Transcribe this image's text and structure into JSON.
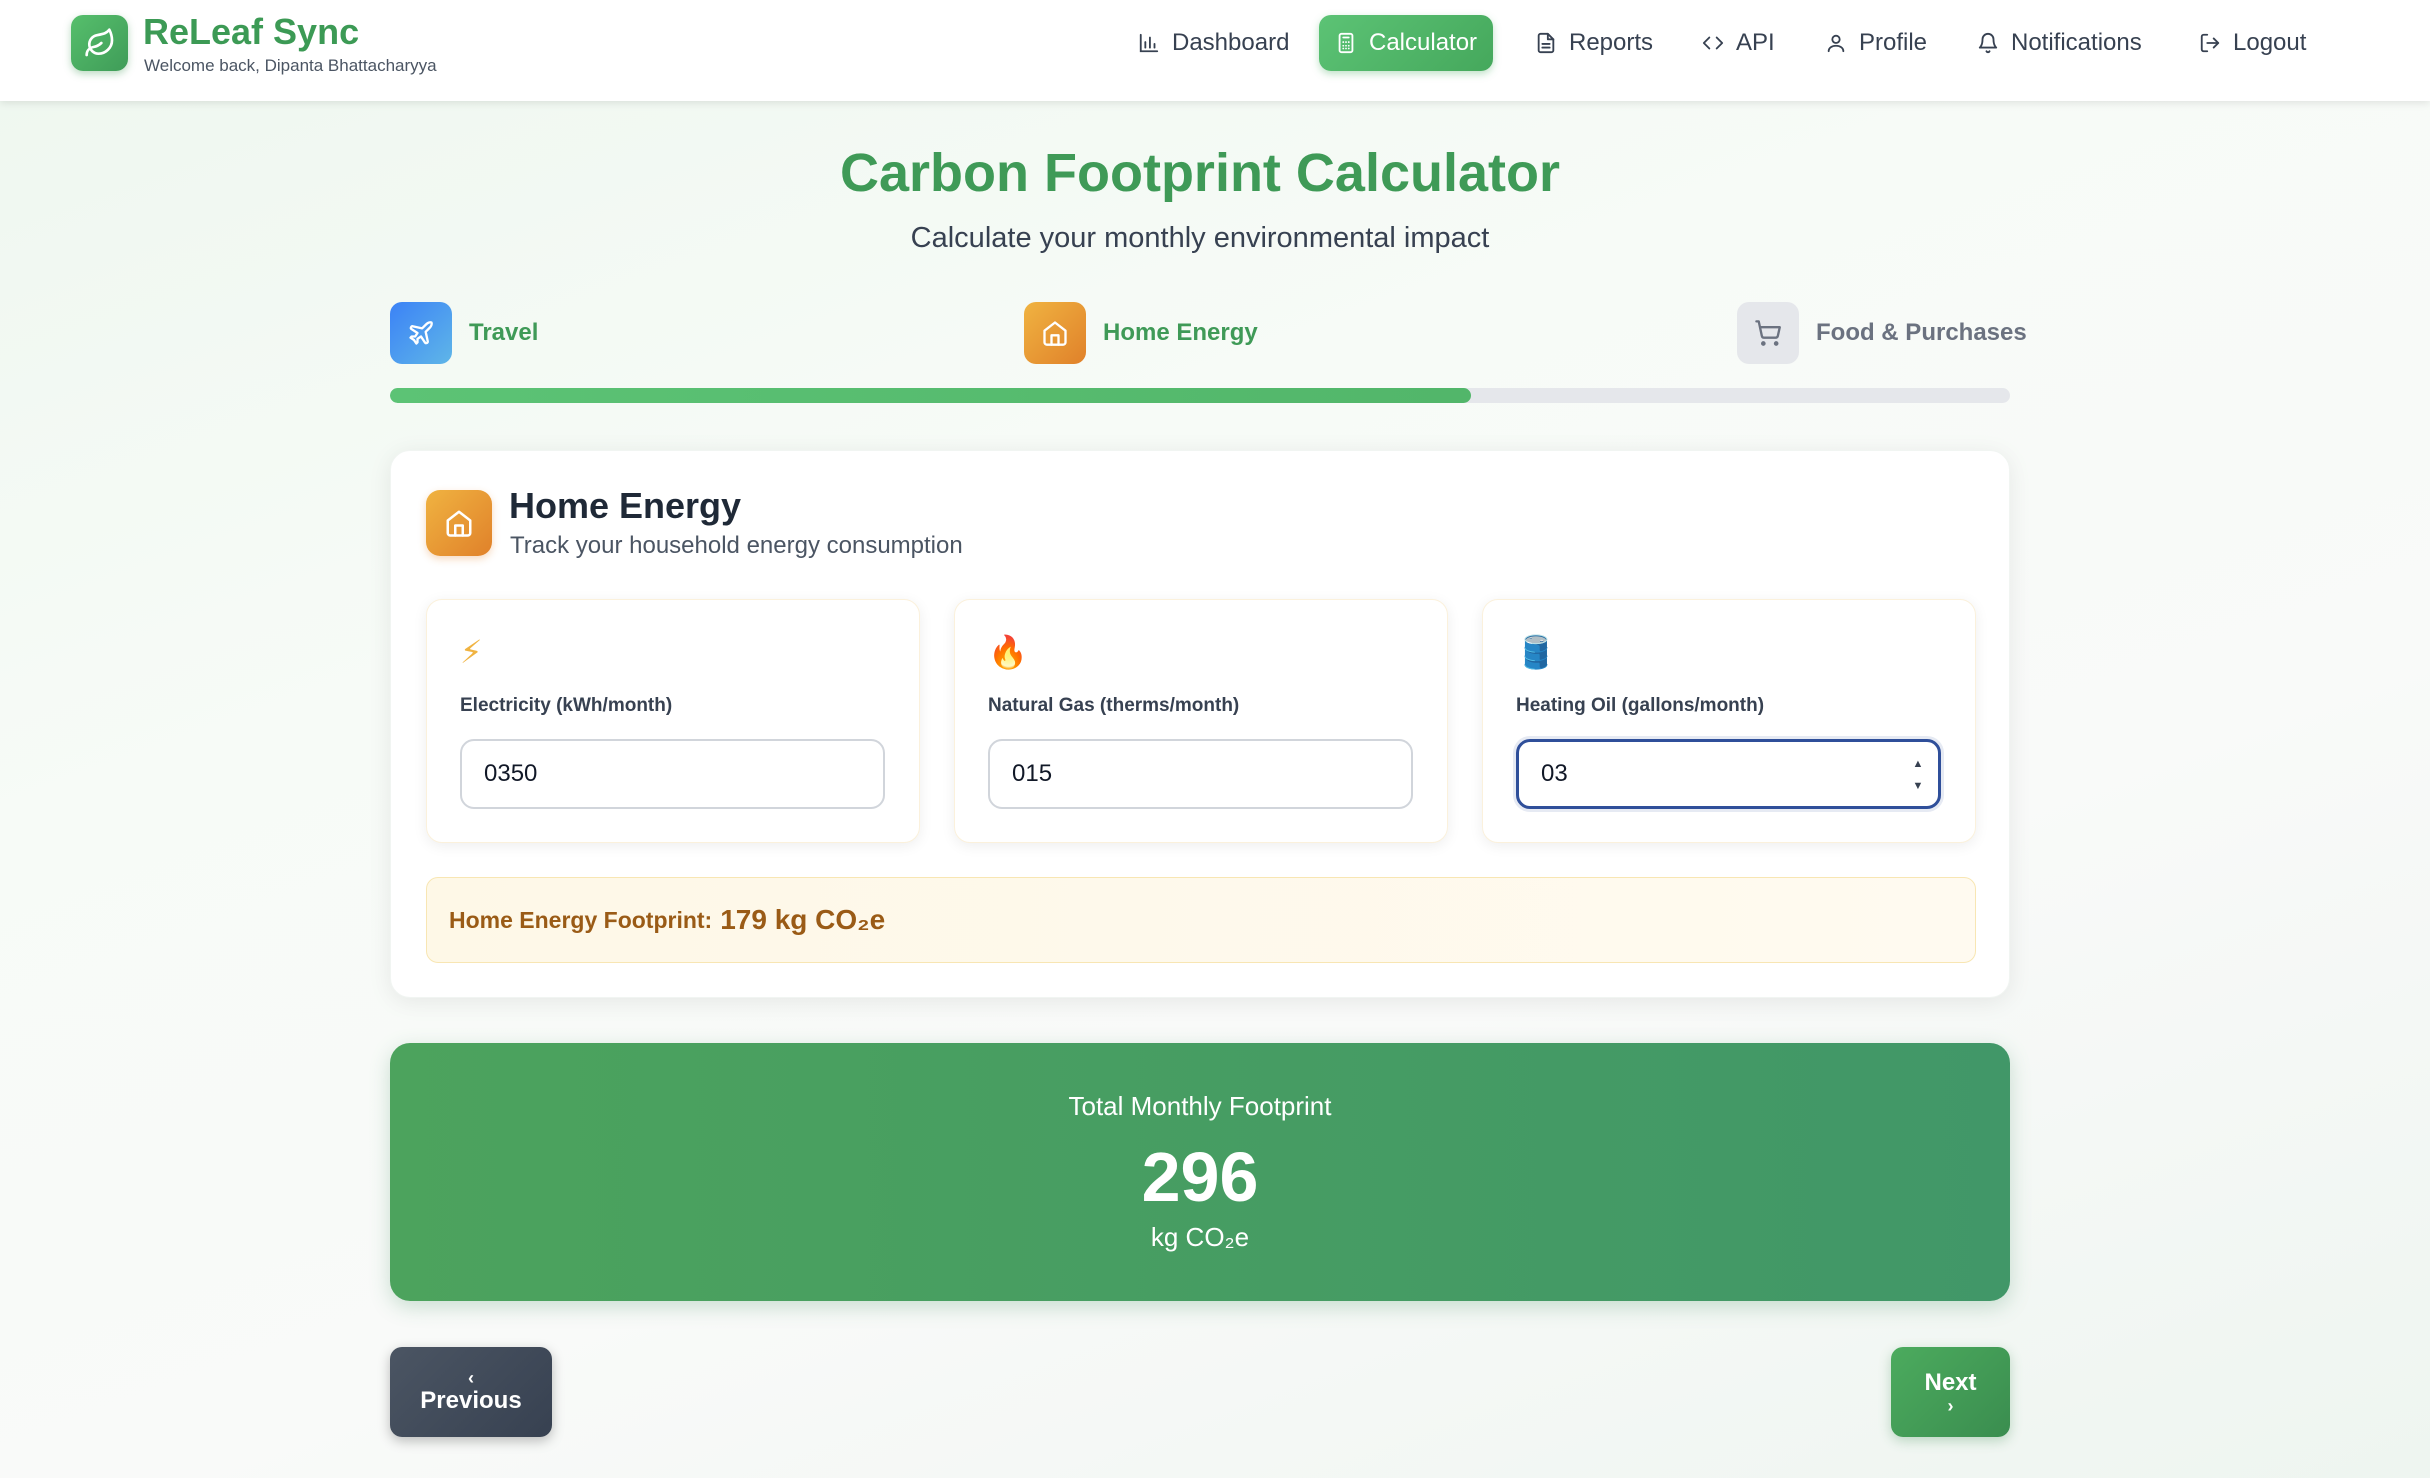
{
  "header": {
    "brand": "ReLeaf Sync",
    "welcome": "Welcome back, Dipanta Bhattacharyya",
    "nav": [
      {
        "label": "Dashboard",
        "icon": "bar-chart-icon",
        "active": false
      },
      {
        "label": "Calculator",
        "icon": "calculator-icon",
        "active": true
      },
      {
        "label": "Reports",
        "icon": "document-icon",
        "active": false
      },
      {
        "label": "API",
        "icon": "code-icon",
        "active": false
      },
      {
        "label": "Profile",
        "icon": "user-icon",
        "active": false
      },
      {
        "label": "Notifications",
        "icon": "bell-icon",
        "active": false
      },
      {
        "label": "Logout",
        "icon": "logout-icon",
        "active": false
      }
    ]
  },
  "page": {
    "title": "Carbon Footprint Calculator",
    "subtitle": "Calculate your monthly environmental impact"
  },
  "steps": [
    {
      "label": "Travel",
      "icon": "airplane-icon",
      "state": "complete"
    },
    {
      "label": "Home Energy",
      "icon": "house-icon",
      "state": "current"
    },
    {
      "label": "Food & Purchases",
      "icon": "cart-icon",
      "state": "pending"
    }
  ],
  "progress": {
    "fraction": 0.667
  },
  "section": {
    "title": "Home Energy",
    "subtitle": "Track your household energy consumption",
    "fields": [
      {
        "emoji": "⚡",
        "label": "Electricity (kWh/month)",
        "value": "0350"
      },
      {
        "emoji": "🔥",
        "label": "Natural Gas (therms/month)",
        "value": "015"
      },
      {
        "emoji": "🛢️",
        "label": "Heating Oil (gallons/month)",
        "value": "03"
      }
    ],
    "footprint_label": "Home Energy Footprint:",
    "footprint_value": "179 kg CO₂e"
  },
  "total": {
    "label": "Total Monthly Footprint",
    "value": "296",
    "unit": "kg CO₂e"
  },
  "buttons": {
    "previous": "Previous",
    "next": "Next"
  },
  "colors": {
    "brand_green": "#3f9a57",
    "accent_orange": "#e0812a",
    "footprint_text": "#9a5b16",
    "focus_border": "#2f4f9a"
  }
}
